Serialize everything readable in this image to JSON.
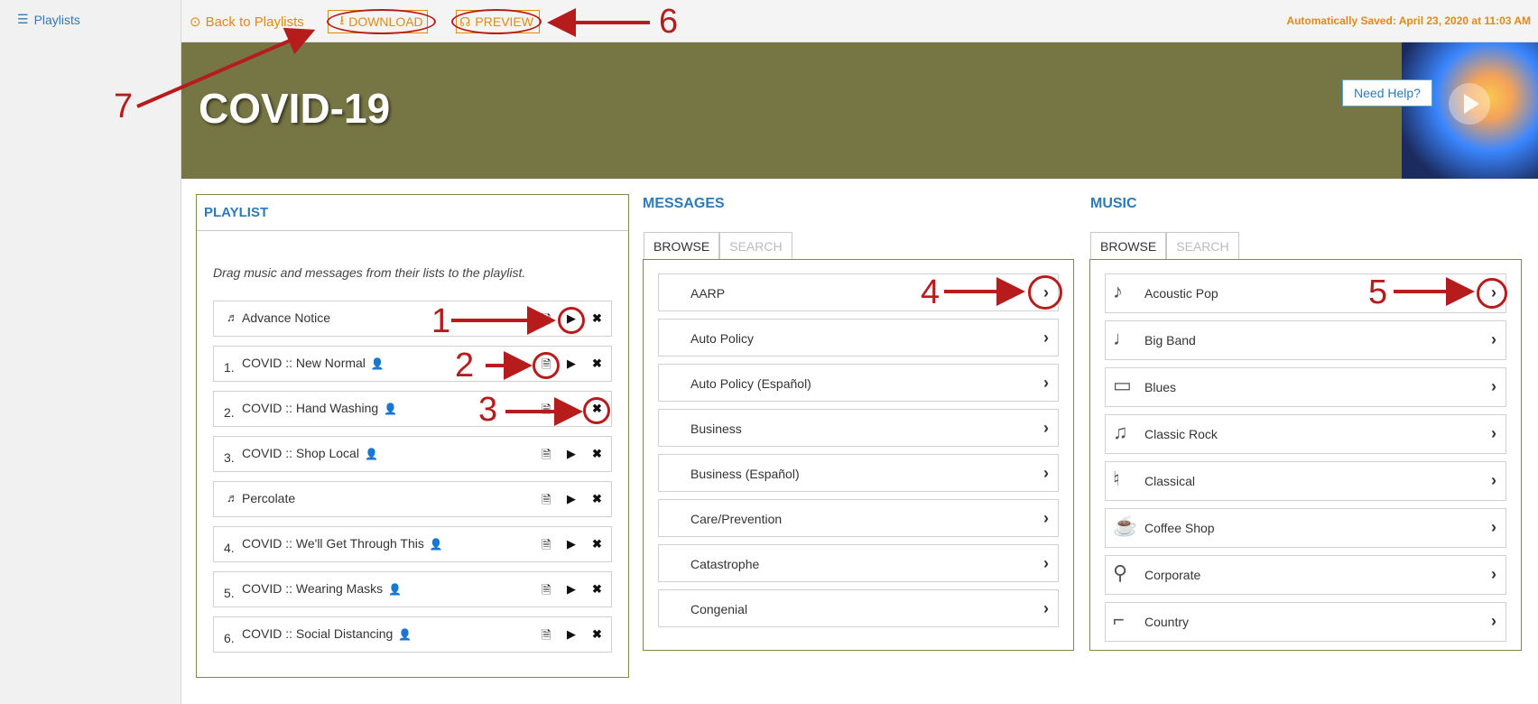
{
  "sidebar": {
    "playlists_label": "Playlists"
  },
  "topbar": {
    "back_label": "Back to Playlists",
    "download_label": "DOWNLOAD",
    "preview_label": "PREVIEW",
    "saved_text": "Automatically Saved: April 23, 2020 at 11:03 AM"
  },
  "banner": {
    "title": "COVID-19",
    "help_label": "Need Help?"
  },
  "playlist": {
    "heading": "PLAYLIST",
    "hint": "Drag music and messages from their lists to the playlist.",
    "rows": [
      {
        "num": "",
        "label": "Advance Notice"
      },
      {
        "num": "1.",
        "label": "COVID :: New Normal"
      },
      {
        "num": "2.",
        "label": "COVID :: Hand Washing"
      },
      {
        "num": "3.",
        "label": "COVID :: Shop Local"
      },
      {
        "num": "",
        "label": "Percolate"
      },
      {
        "num": "4.",
        "label": "COVID :: We'll Get Through This"
      },
      {
        "num": "5.",
        "label": "COVID :: Wearing Masks"
      },
      {
        "num": "6.",
        "label": "COVID :: Social Distancing"
      }
    ]
  },
  "messages": {
    "heading": "MESSAGES",
    "tab_browse": "BROWSE",
    "tab_search": "SEARCH",
    "items": [
      "AARP",
      "Auto Policy",
      "Auto Policy (Español)",
      "Business",
      "Business (Español)",
      "Care/Prevention",
      "Catastrophe",
      "Congenial"
    ]
  },
  "music": {
    "heading": "MUSIC",
    "tab_browse": "BROWSE",
    "tab_search": "SEARCH",
    "items": [
      "Acoustic Pop",
      "Big Band",
      "Blues",
      "Classic Rock",
      "Classical",
      "Coffee Shop",
      "Corporate",
      "Country"
    ]
  },
  "annotations": [
    "1",
    "2",
    "3",
    "4",
    "5",
    "6",
    "7"
  ],
  "colors": {
    "accent": "#2e7ab8",
    "orange": "#e08a12",
    "banner": "#767645",
    "annotation": "#b71c1c"
  }
}
